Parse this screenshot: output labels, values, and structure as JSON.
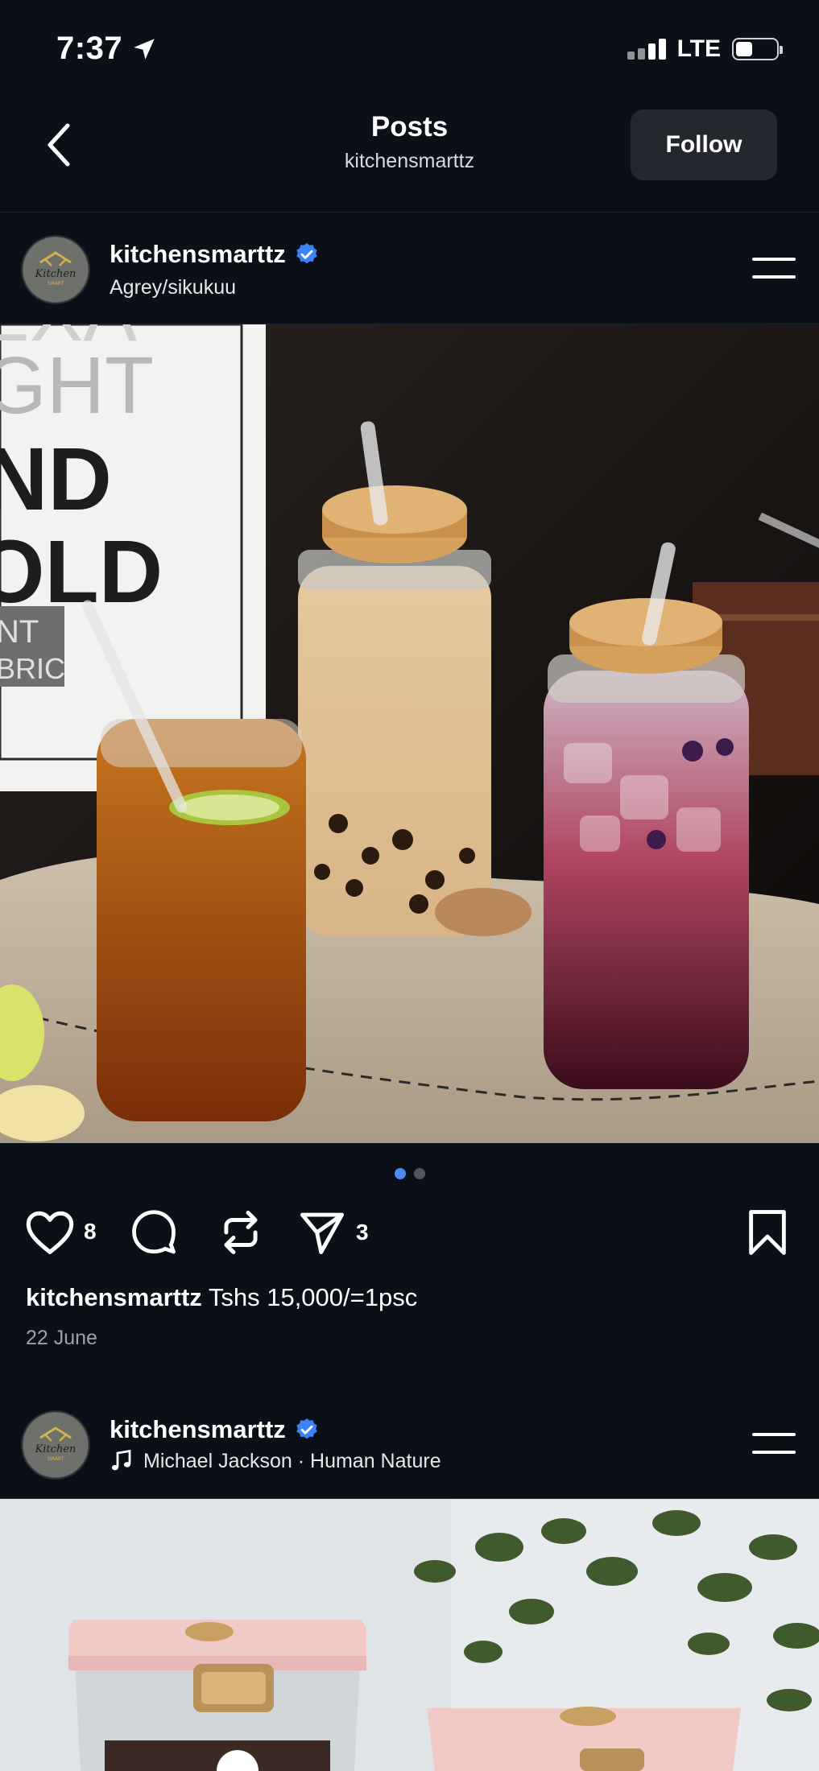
{
  "status_bar": {
    "time": "7:37",
    "network": "LTE"
  },
  "header": {
    "title": "Posts",
    "subtitle": "kitchensmarttz",
    "follow_label": "Follow"
  },
  "posts": [
    {
      "username": "kitchensmarttz",
      "subline": "Agrey/sikukuu",
      "image_text": [
        "EXA",
        "GHT",
        "ND",
        "OLD",
        "NT",
        "BRIC"
      ],
      "likes": "8",
      "shares": "3",
      "caption_user": "kitchensmarttz",
      "caption_text": "Tshs 15,000/=1psc",
      "date": "22 June",
      "carousel": {
        "count": 2,
        "active": 1
      }
    },
    {
      "username": "kitchensmarttz",
      "music": "Michael Jackson · Human Nature"
    }
  ],
  "colors": {
    "background": "#0b0f17",
    "accent": "#4f8bf5",
    "verified": "#3b82f6"
  }
}
